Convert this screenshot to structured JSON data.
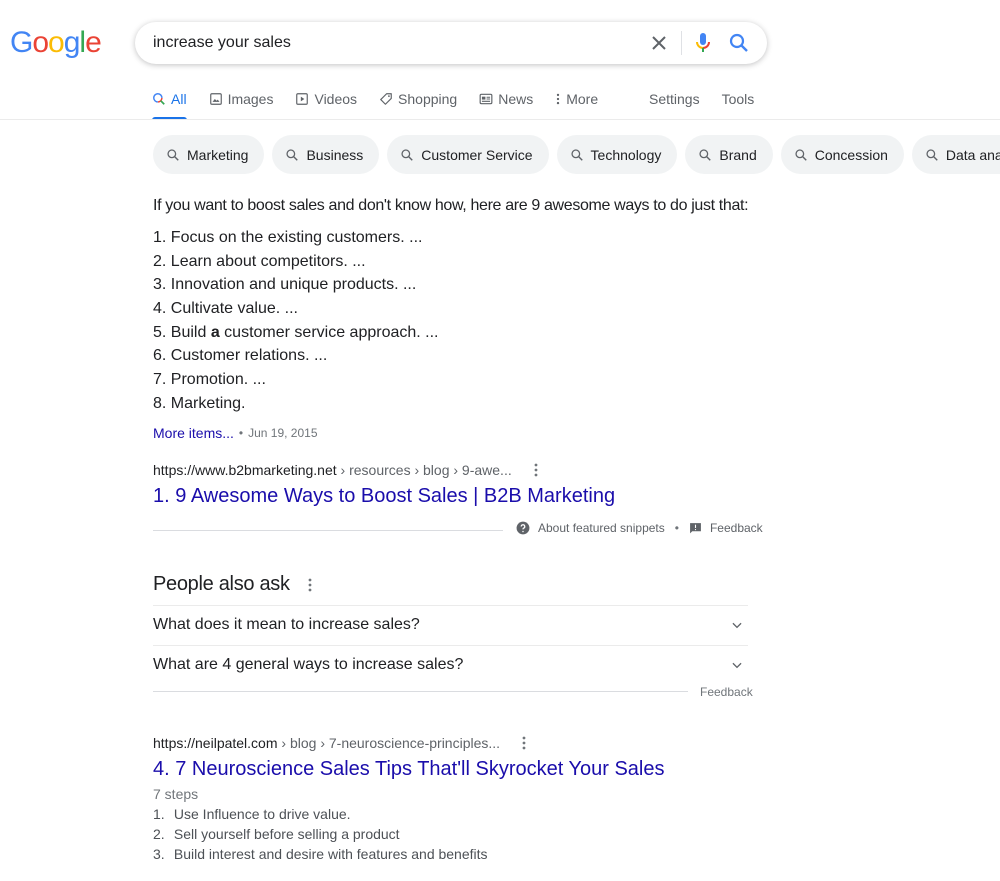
{
  "logo": {
    "letters": [
      {
        "char": "G",
        "color": "#4285F4"
      },
      {
        "char": "o",
        "color": "#EA4335"
      },
      {
        "char": "o",
        "color": "#FBBC05"
      },
      {
        "char": "g",
        "color": "#4285F4"
      },
      {
        "char": "l",
        "color": "#34A853"
      },
      {
        "char": "e",
        "color": "#EA4335"
      }
    ]
  },
  "search": {
    "value": "increase your sales",
    "clear_icon": "close-icon",
    "mic_icon": "microphone-icon",
    "search_icon": "search-icon"
  },
  "tabs": [
    {
      "label": "All",
      "icon": "search-icon",
      "active": true
    },
    {
      "label": "Images",
      "icon": "image-icon"
    },
    {
      "label": "Videos",
      "icon": "play-icon"
    },
    {
      "label": "Shopping",
      "icon": "tag-icon"
    },
    {
      "label": "News",
      "icon": "newspaper-icon"
    },
    {
      "label": "More",
      "icon": "kebab-icon"
    }
  ],
  "tabs_right": [
    {
      "label": "Settings"
    },
    {
      "label": "Tools"
    }
  ],
  "chips": [
    "Marketing",
    "Business",
    "Customer Service",
    "Technology",
    "Brand",
    "Concession",
    "Data analysis"
  ],
  "featured_snippet": {
    "heading": "If you want to boost sales and don't know how, here are 9 awesome ways to do just that:",
    "items": [
      {
        "num": "1.",
        "text": "Focus on the existing customers. ..."
      },
      {
        "num": "2.",
        "text": "Learn about competitors. ..."
      },
      {
        "num": "3.",
        "text": "Innovation and unique products. ..."
      },
      {
        "num": "4.",
        "text": "Cultivate value. ..."
      },
      {
        "num": "5.",
        "pre": "Build ",
        "bold": "a",
        "post": " customer service approach. ..."
      },
      {
        "num": "6.",
        "text": "Customer relations. ..."
      },
      {
        "num": "7.",
        "text": "Promotion. ..."
      },
      {
        "num": "8.",
        "text": "Marketing."
      }
    ],
    "more_items": "More items...",
    "dot": "•",
    "date": "Jun 19, 2015",
    "cite_domain": "https://www.b2bmarketing.net",
    "cite_path": " › resources › blog › 9-awe...",
    "title": "1. 9 Awesome Ways to Boost Sales | B2B Marketing",
    "about_label": "About featured snippets",
    "feedback_label": "Feedback"
  },
  "people_also_ask": {
    "title": "People also ask",
    "questions": [
      "What does it mean to increase sales?",
      "What are 4 general ways to increase sales?"
    ],
    "feedback_label": "Feedback"
  },
  "result2": {
    "cite_domain": "https://neilpatel.com",
    "cite_path": " › blog › 7-neuroscience-principles...",
    "title": "4. 7 Neuroscience Sales Tips That'll Skyrocket Your Sales",
    "steps_label": "7 steps",
    "steps": [
      {
        "num": "1.",
        "text": "Use Influence to drive value."
      },
      {
        "num": "2.",
        "text": "Sell yourself before selling a product"
      },
      {
        "num": "3.",
        "text": "Build interest and desire with features and benefits"
      }
    ]
  },
  "colors": {
    "link": "#1a0dab",
    "accent": "#1a73e8",
    "chip_bg": "#f1f3f4",
    "secondary_text": "#70757a"
  }
}
